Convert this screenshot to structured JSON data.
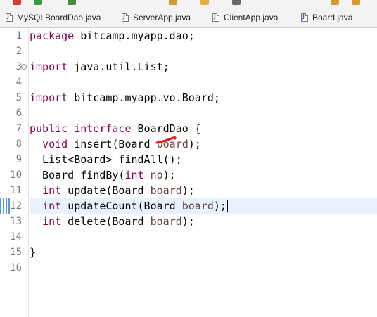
{
  "tabs": [
    {
      "label": "MySQLBoardDao.java",
      "active": true
    },
    {
      "label": "ServerApp.java",
      "active": false
    },
    {
      "label": "ClientApp.java",
      "active": false
    },
    {
      "label": "Board.java",
      "active": false
    }
  ],
  "editor": {
    "current_line": 12,
    "lines": [
      {
        "n": "1",
        "tokens": [
          {
            "t": "package",
            "c": "kw"
          },
          {
            "t": " bitcamp.myapp.dao;"
          }
        ]
      },
      {
        "n": "2",
        "tokens": []
      },
      {
        "n": "3",
        "fold": true,
        "tokens": [
          {
            "t": "import",
            "c": "kw"
          },
          {
            "t": " java.util.List;"
          }
        ]
      },
      {
        "n": "4",
        "tokens": []
      },
      {
        "n": "5",
        "tokens": [
          {
            "t": "import",
            "c": "kw"
          },
          {
            "t": " bitcamp.myapp.vo.Board;"
          }
        ]
      },
      {
        "n": "6",
        "tokens": []
      },
      {
        "n": "7",
        "tokens": [
          {
            "t": "public",
            "c": "kw"
          },
          {
            "t": " "
          },
          {
            "t": "interface",
            "c": "kw"
          },
          {
            "t": " BoardDao {"
          }
        ]
      },
      {
        "n": "8",
        "tokens": [
          {
            "t": "  "
          },
          {
            "t": "void",
            "c": "kw"
          },
          {
            "t": " insert(Board "
          },
          {
            "t": "board",
            "c": "param"
          },
          {
            "t": ");"
          }
        ]
      },
      {
        "n": "9",
        "tokens": [
          {
            "t": "  List<Board> findAll();"
          }
        ]
      },
      {
        "n": "10",
        "tokens": [
          {
            "t": "  Board findBy("
          },
          {
            "t": "int",
            "c": "kw"
          },
          {
            "t": " "
          },
          {
            "t": "no",
            "c": "param"
          },
          {
            "t": ");"
          }
        ]
      },
      {
        "n": "11",
        "tokens": [
          {
            "t": "  "
          },
          {
            "t": "int",
            "c": "kw"
          },
          {
            "t": " update(Board "
          },
          {
            "t": "board",
            "c": "param"
          },
          {
            "t": ");"
          }
        ]
      },
      {
        "n": "12",
        "tokens": [
          {
            "t": "  "
          },
          {
            "t": "int",
            "c": "kw"
          },
          {
            "t": " updateCount(Board "
          },
          {
            "t": "board",
            "c": "param"
          },
          {
            "t": ");"
          }
        ]
      },
      {
        "n": "13",
        "tokens": [
          {
            "t": "  "
          },
          {
            "t": "int",
            "c": "kw"
          },
          {
            "t": " delete(Board "
          },
          {
            "t": "board",
            "c": "param"
          },
          {
            "t": ");"
          }
        ]
      },
      {
        "n": "14",
        "tokens": []
      },
      {
        "n": "15",
        "tokens": [
          {
            "t": "}"
          }
        ]
      },
      {
        "n": "16",
        "tokens": []
      }
    ]
  },
  "colors": {
    "keyword": "#7f0055",
    "parameter": "#6a3e3e",
    "current_line_bg": "#e8f2fe",
    "annotation": "#e8131b"
  }
}
